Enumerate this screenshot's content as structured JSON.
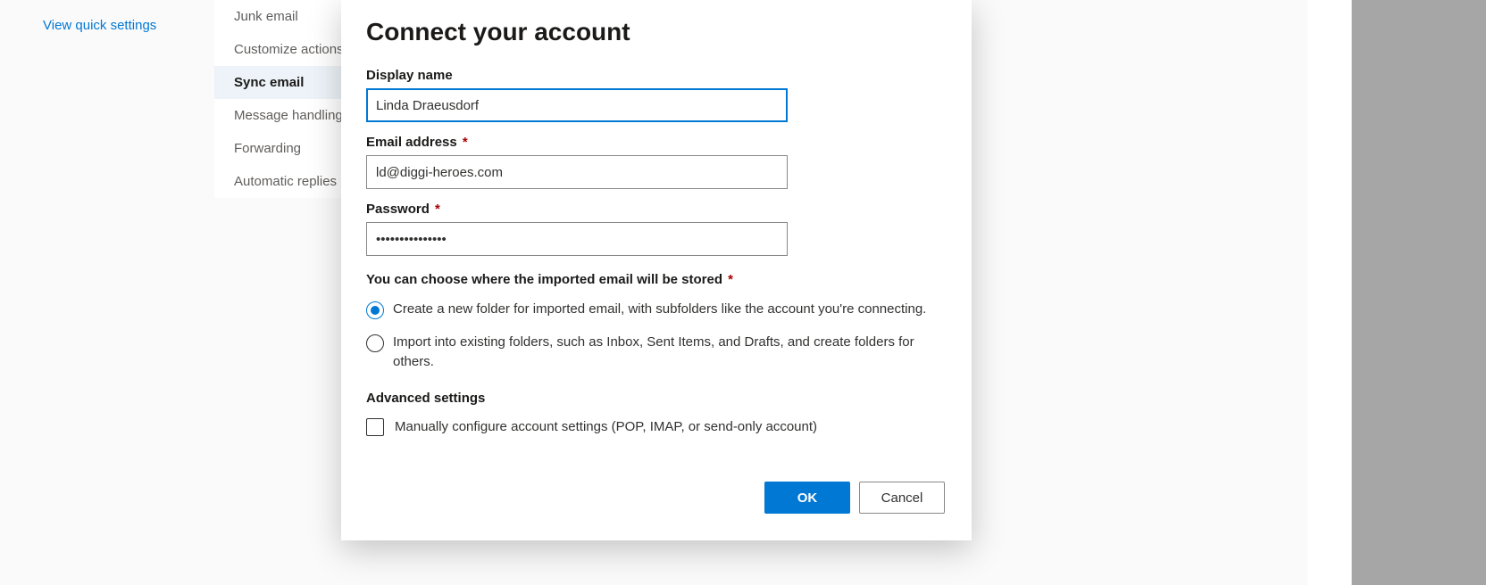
{
  "left_link": "View quick settings",
  "sidebar": {
    "items": [
      {
        "label": "Junk email",
        "selected": false
      },
      {
        "label": "Customize actions",
        "selected": false
      },
      {
        "label": "Sync email",
        "selected": true
      },
      {
        "label": "Message handling",
        "selected": false
      },
      {
        "label": "Forwarding",
        "selected": false
      },
      {
        "label": "Automatic replies",
        "selected": false
      }
    ]
  },
  "dialog": {
    "title": "Connect your account",
    "fields": {
      "display_name_label": "Display name",
      "display_name_value": "Linda Draeusdorf",
      "email_label": "Email address",
      "email_value": "ld@diggi-heroes.com",
      "password_label": "Password",
      "password_value": "•••••••••••••••"
    },
    "storage": {
      "heading": "You can choose where the imported email will be stored",
      "option_new": "Create a new folder for imported email, with subfolders like the account you're connecting.",
      "option_existing": "Import into existing folders, such as Inbox, Sent Items, and Drafts, and create folders for others."
    },
    "advanced": {
      "heading": "Advanced settings",
      "manual_label": "Manually configure account settings (POP, IMAP, or send-only account)"
    },
    "buttons": {
      "ok": "OK",
      "cancel": "Cancel"
    }
  }
}
